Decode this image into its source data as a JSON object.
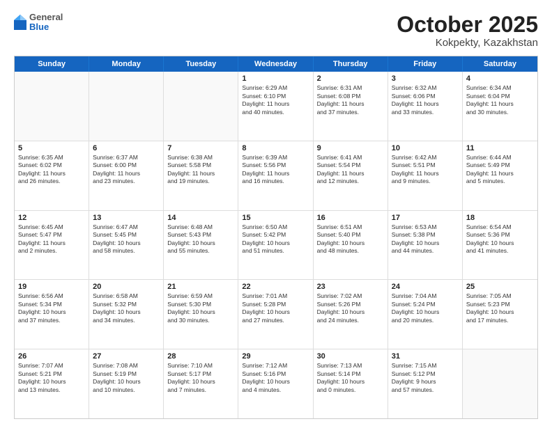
{
  "header": {
    "logo": {
      "general": "General",
      "blue": "Blue"
    },
    "month": "October 2025",
    "location": "Kokpekty, Kazakhstan"
  },
  "weekdays": [
    "Sunday",
    "Monday",
    "Tuesday",
    "Wednesday",
    "Thursday",
    "Friday",
    "Saturday"
  ],
  "rows": [
    [
      {
        "day": "",
        "text": "",
        "empty": true
      },
      {
        "day": "",
        "text": "",
        "empty": true
      },
      {
        "day": "",
        "text": "",
        "empty": true
      },
      {
        "day": "1",
        "text": "Sunrise: 6:29 AM\nSunset: 6:10 PM\nDaylight: 11 hours\nand 40 minutes."
      },
      {
        "day": "2",
        "text": "Sunrise: 6:31 AM\nSunset: 6:08 PM\nDaylight: 11 hours\nand 37 minutes."
      },
      {
        "day": "3",
        "text": "Sunrise: 6:32 AM\nSunset: 6:06 PM\nDaylight: 11 hours\nand 33 minutes."
      },
      {
        "day": "4",
        "text": "Sunrise: 6:34 AM\nSunset: 6:04 PM\nDaylight: 11 hours\nand 30 minutes."
      }
    ],
    [
      {
        "day": "5",
        "text": "Sunrise: 6:35 AM\nSunset: 6:02 PM\nDaylight: 11 hours\nand 26 minutes."
      },
      {
        "day": "6",
        "text": "Sunrise: 6:37 AM\nSunset: 6:00 PM\nDaylight: 11 hours\nand 23 minutes."
      },
      {
        "day": "7",
        "text": "Sunrise: 6:38 AM\nSunset: 5:58 PM\nDaylight: 11 hours\nand 19 minutes."
      },
      {
        "day": "8",
        "text": "Sunrise: 6:39 AM\nSunset: 5:56 PM\nDaylight: 11 hours\nand 16 minutes."
      },
      {
        "day": "9",
        "text": "Sunrise: 6:41 AM\nSunset: 5:54 PM\nDaylight: 11 hours\nand 12 minutes."
      },
      {
        "day": "10",
        "text": "Sunrise: 6:42 AM\nSunset: 5:51 PM\nDaylight: 11 hours\nand 9 minutes."
      },
      {
        "day": "11",
        "text": "Sunrise: 6:44 AM\nSunset: 5:49 PM\nDaylight: 11 hours\nand 5 minutes."
      }
    ],
    [
      {
        "day": "12",
        "text": "Sunrise: 6:45 AM\nSunset: 5:47 PM\nDaylight: 11 hours\nand 2 minutes."
      },
      {
        "day": "13",
        "text": "Sunrise: 6:47 AM\nSunset: 5:45 PM\nDaylight: 10 hours\nand 58 minutes."
      },
      {
        "day": "14",
        "text": "Sunrise: 6:48 AM\nSunset: 5:43 PM\nDaylight: 10 hours\nand 55 minutes."
      },
      {
        "day": "15",
        "text": "Sunrise: 6:50 AM\nSunset: 5:42 PM\nDaylight: 10 hours\nand 51 minutes."
      },
      {
        "day": "16",
        "text": "Sunrise: 6:51 AM\nSunset: 5:40 PM\nDaylight: 10 hours\nand 48 minutes."
      },
      {
        "day": "17",
        "text": "Sunrise: 6:53 AM\nSunset: 5:38 PM\nDaylight: 10 hours\nand 44 minutes."
      },
      {
        "day": "18",
        "text": "Sunrise: 6:54 AM\nSunset: 5:36 PM\nDaylight: 10 hours\nand 41 minutes."
      }
    ],
    [
      {
        "day": "19",
        "text": "Sunrise: 6:56 AM\nSunset: 5:34 PM\nDaylight: 10 hours\nand 37 minutes."
      },
      {
        "day": "20",
        "text": "Sunrise: 6:58 AM\nSunset: 5:32 PM\nDaylight: 10 hours\nand 34 minutes."
      },
      {
        "day": "21",
        "text": "Sunrise: 6:59 AM\nSunset: 5:30 PM\nDaylight: 10 hours\nand 30 minutes."
      },
      {
        "day": "22",
        "text": "Sunrise: 7:01 AM\nSunset: 5:28 PM\nDaylight: 10 hours\nand 27 minutes."
      },
      {
        "day": "23",
        "text": "Sunrise: 7:02 AM\nSunset: 5:26 PM\nDaylight: 10 hours\nand 24 minutes."
      },
      {
        "day": "24",
        "text": "Sunrise: 7:04 AM\nSunset: 5:24 PM\nDaylight: 10 hours\nand 20 minutes."
      },
      {
        "day": "25",
        "text": "Sunrise: 7:05 AM\nSunset: 5:23 PM\nDaylight: 10 hours\nand 17 minutes."
      }
    ],
    [
      {
        "day": "26",
        "text": "Sunrise: 7:07 AM\nSunset: 5:21 PM\nDaylight: 10 hours\nand 13 minutes."
      },
      {
        "day": "27",
        "text": "Sunrise: 7:08 AM\nSunset: 5:19 PM\nDaylight: 10 hours\nand 10 minutes."
      },
      {
        "day": "28",
        "text": "Sunrise: 7:10 AM\nSunset: 5:17 PM\nDaylight: 10 hours\nand 7 minutes."
      },
      {
        "day": "29",
        "text": "Sunrise: 7:12 AM\nSunset: 5:16 PM\nDaylight: 10 hours\nand 4 minutes."
      },
      {
        "day": "30",
        "text": "Sunrise: 7:13 AM\nSunset: 5:14 PM\nDaylight: 10 hours\nand 0 minutes."
      },
      {
        "day": "31",
        "text": "Sunrise: 7:15 AM\nSunset: 5:12 PM\nDaylight: 9 hours\nand 57 minutes."
      },
      {
        "day": "",
        "text": "",
        "empty": true
      }
    ]
  ]
}
